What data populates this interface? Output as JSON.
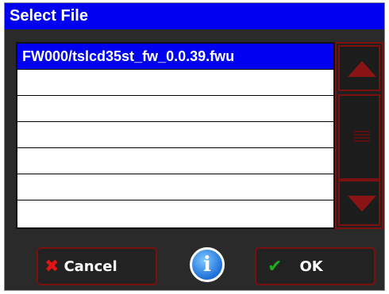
{
  "dialog": {
    "title": "Select File"
  },
  "file_list": {
    "rows": [
      "FW000/tslcd35st_fw_0.0.39.fwu",
      "",
      "",
      "",
      "",
      "",
      ""
    ],
    "selected_index": 0
  },
  "buttons": {
    "cancel_label": "Cancel",
    "ok_label": "OK",
    "info_glyph": "i"
  },
  "icons": {
    "cancel": "x-icon",
    "ok": "check-icon",
    "info": "info-icon",
    "scroll_up": "triangle-up-icon",
    "scroll_down": "triangle-down-icon"
  },
  "colors": {
    "title_bar": "#0000f0",
    "selection": "#0000f0",
    "accent_border": "#7a1010",
    "cancel_icon": "#e01414",
    "ok_icon": "#22aa22"
  }
}
